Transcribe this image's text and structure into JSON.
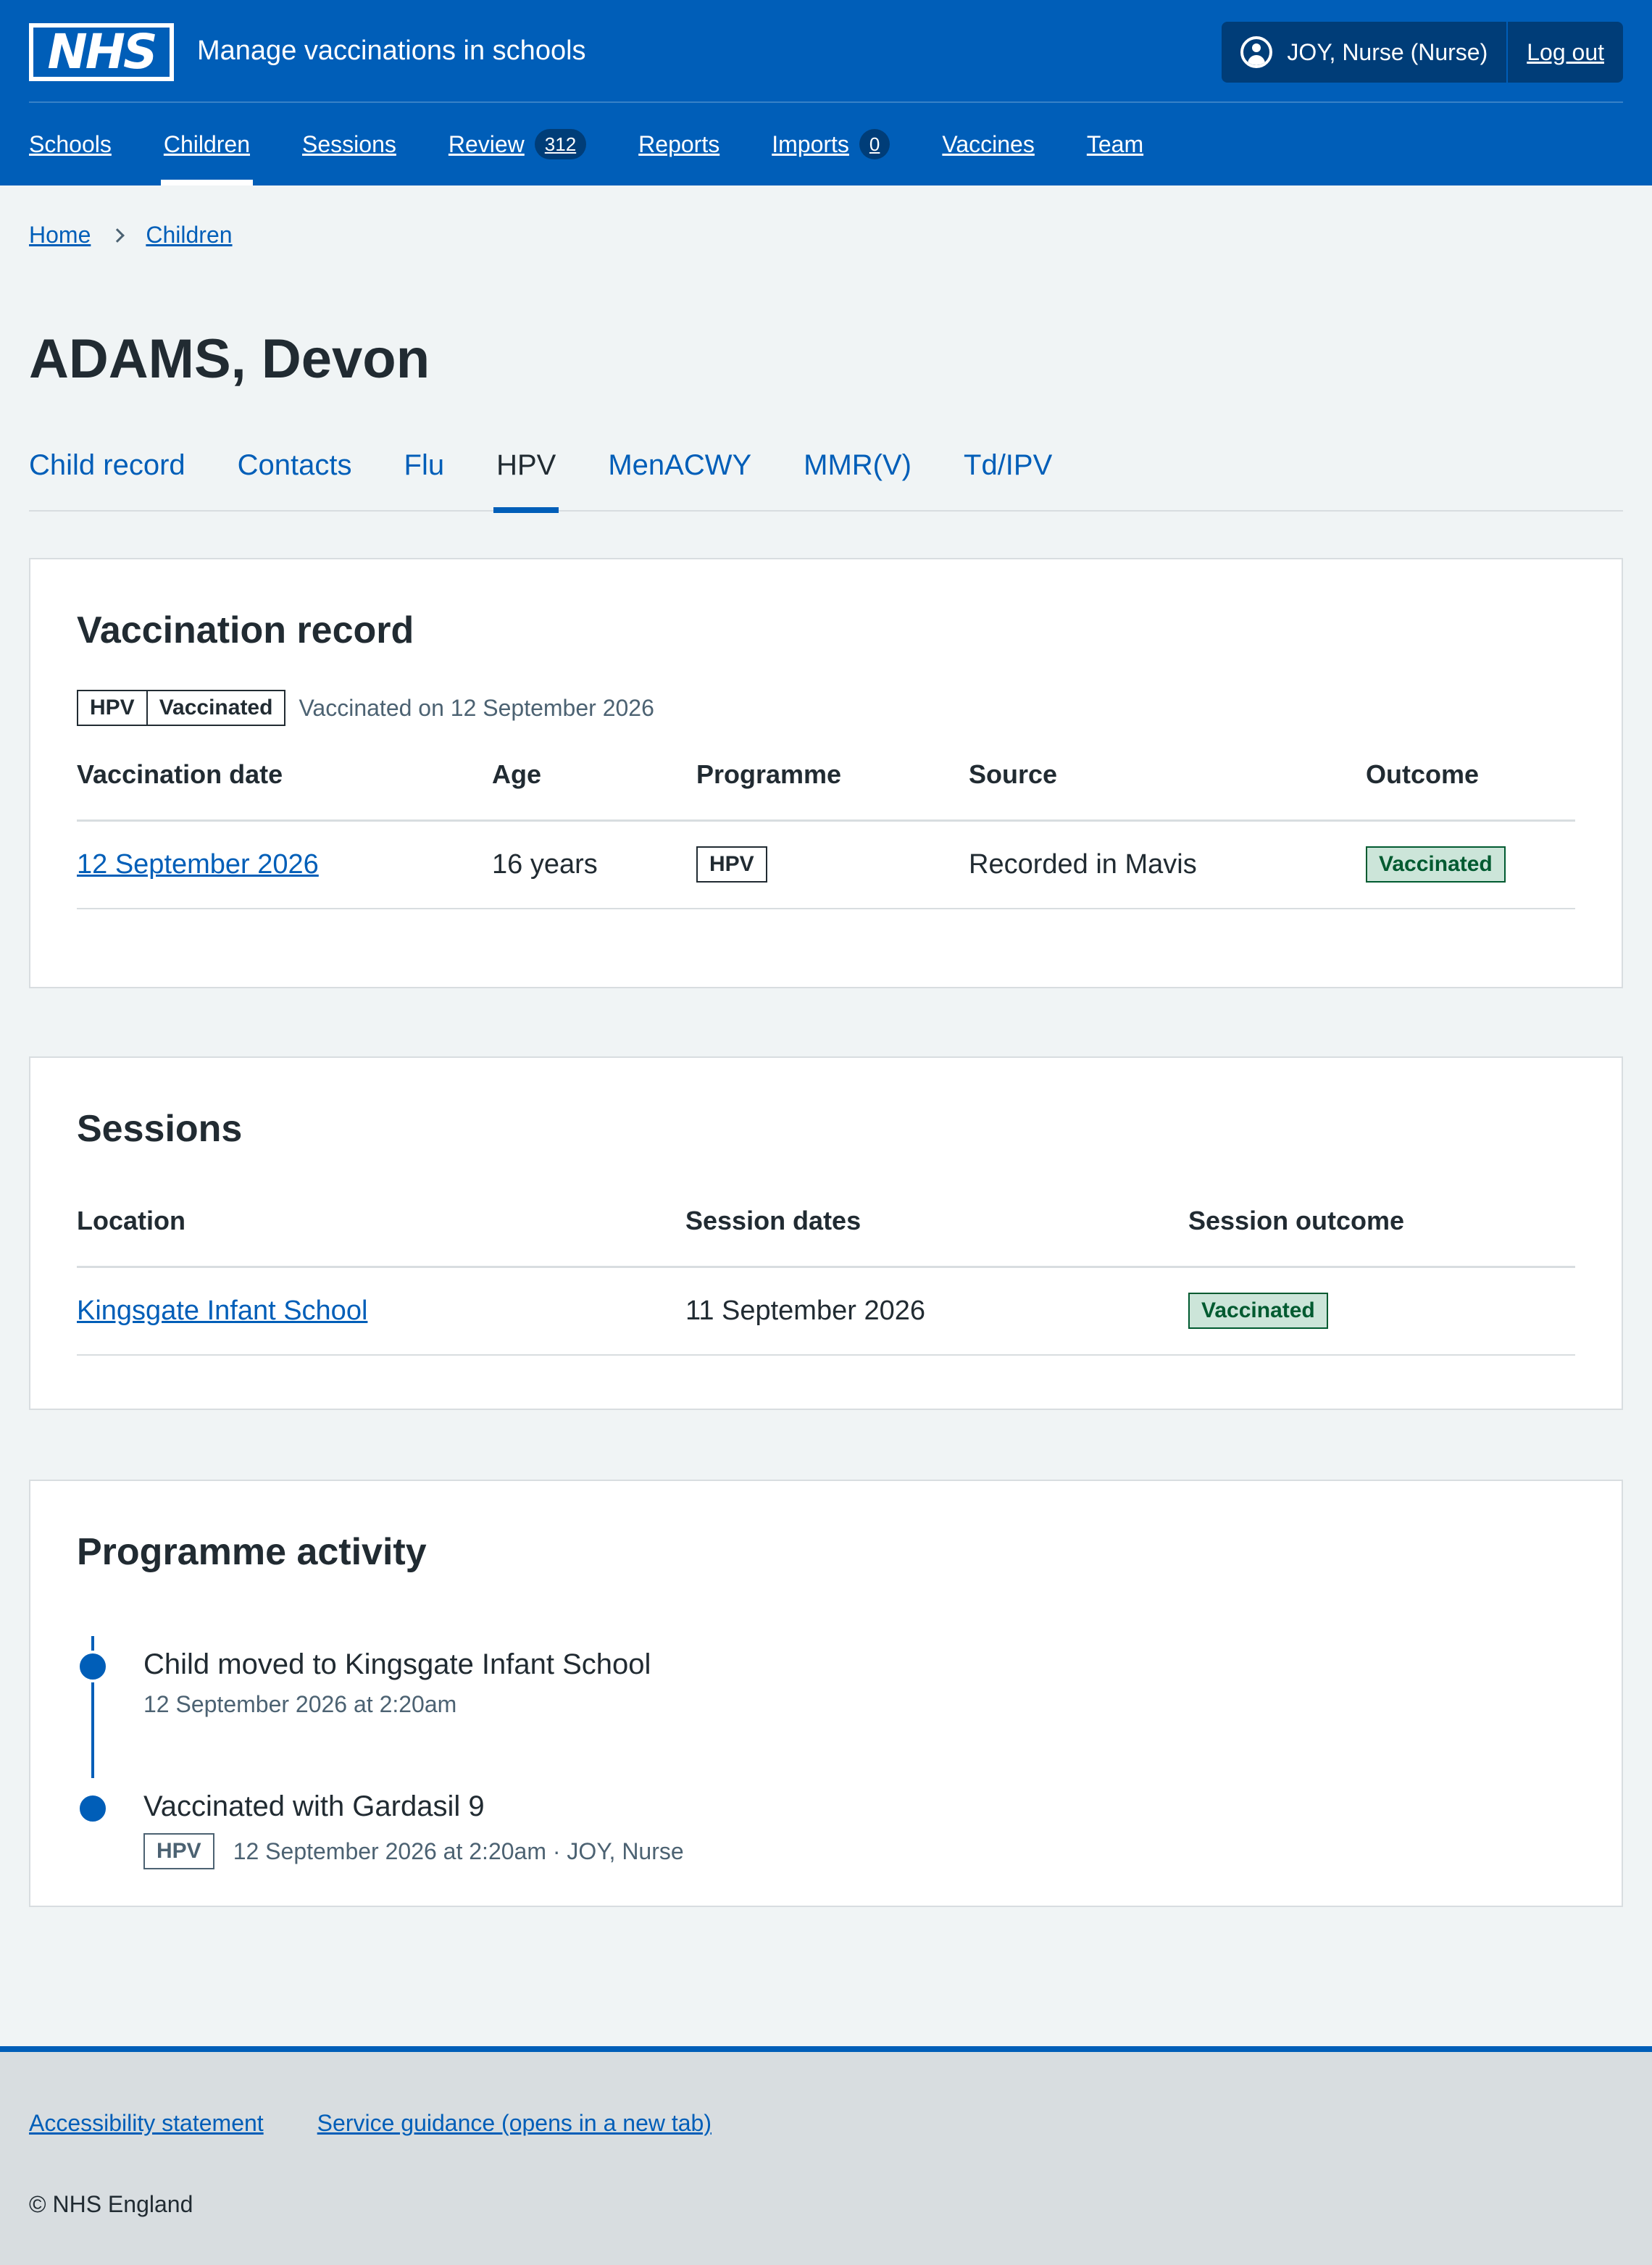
{
  "header": {
    "logo_text": "NHS",
    "service_name": "Manage vaccinations in schools",
    "account_name": "JOY, Nurse (Nurse)",
    "logout_label": "Log out"
  },
  "nav": [
    {
      "label": "Schools"
    },
    {
      "label": "Children",
      "active": true
    },
    {
      "label": "Sessions"
    },
    {
      "label": "Review",
      "count": "312"
    },
    {
      "label": "Reports"
    },
    {
      "label": "Imports",
      "count": "0"
    },
    {
      "label": "Vaccines"
    },
    {
      "label": "Team"
    }
  ],
  "breadcrumb": {
    "home": "Home",
    "current": "Children"
  },
  "page_title": "ADAMS, Devon",
  "tabs": [
    "Child record",
    "Contacts",
    "Flu",
    "HPV",
    "MenACWY",
    "MMR(V)",
    "Td/IPV"
  ],
  "active_tab": "HPV",
  "vaccination_record": {
    "heading": "Vaccination record",
    "tag_programme": "HPV",
    "tag_status": "Vaccinated",
    "status_text": "Vaccinated on 12 September 2026",
    "columns": [
      "Vaccination date",
      "Age",
      "Programme",
      "Source",
      "Outcome"
    ],
    "rows": [
      {
        "date": "12 September 2026",
        "age": "16 years",
        "programme": "HPV",
        "source": "Recorded in Mavis",
        "outcome": "Vaccinated"
      }
    ]
  },
  "sessions": {
    "heading": "Sessions",
    "columns": [
      "Location",
      "Session dates",
      "Session outcome"
    ],
    "rows": [
      {
        "location": "Kingsgate Infant School",
        "dates": "11 September 2026",
        "outcome": "Vaccinated"
      }
    ]
  },
  "activity": {
    "heading": "Programme activity",
    "items": [
      {
        "title": "Child moved to Kingsgate Infant School",
        "meta": "12 September 2026 at 2:20am"
      },
      {
        "title": "Vaccinated with Gardasil 9",
        "tag": "HPV",
        "meta": "12 September 2026 at 2:20am · JOY, Nurse"
      }
    ]
  },
  "footer": {
    "links": [
      "Accessibility statement",
      "Service guidance (opens in a new tab)"
    ],
    "copyright": "© NHS England"
  },
  "colors": {
    "brand_blue": "#005eb8",
    "dark_blue": "#003d78",
    "page_bg": "#f0f4f5",
    "text": "#212b32",
    "secondary_text": "#4c6272",
    "success_bg": "#cce5d9",
    "success_text": "#005a30"
  }
}
